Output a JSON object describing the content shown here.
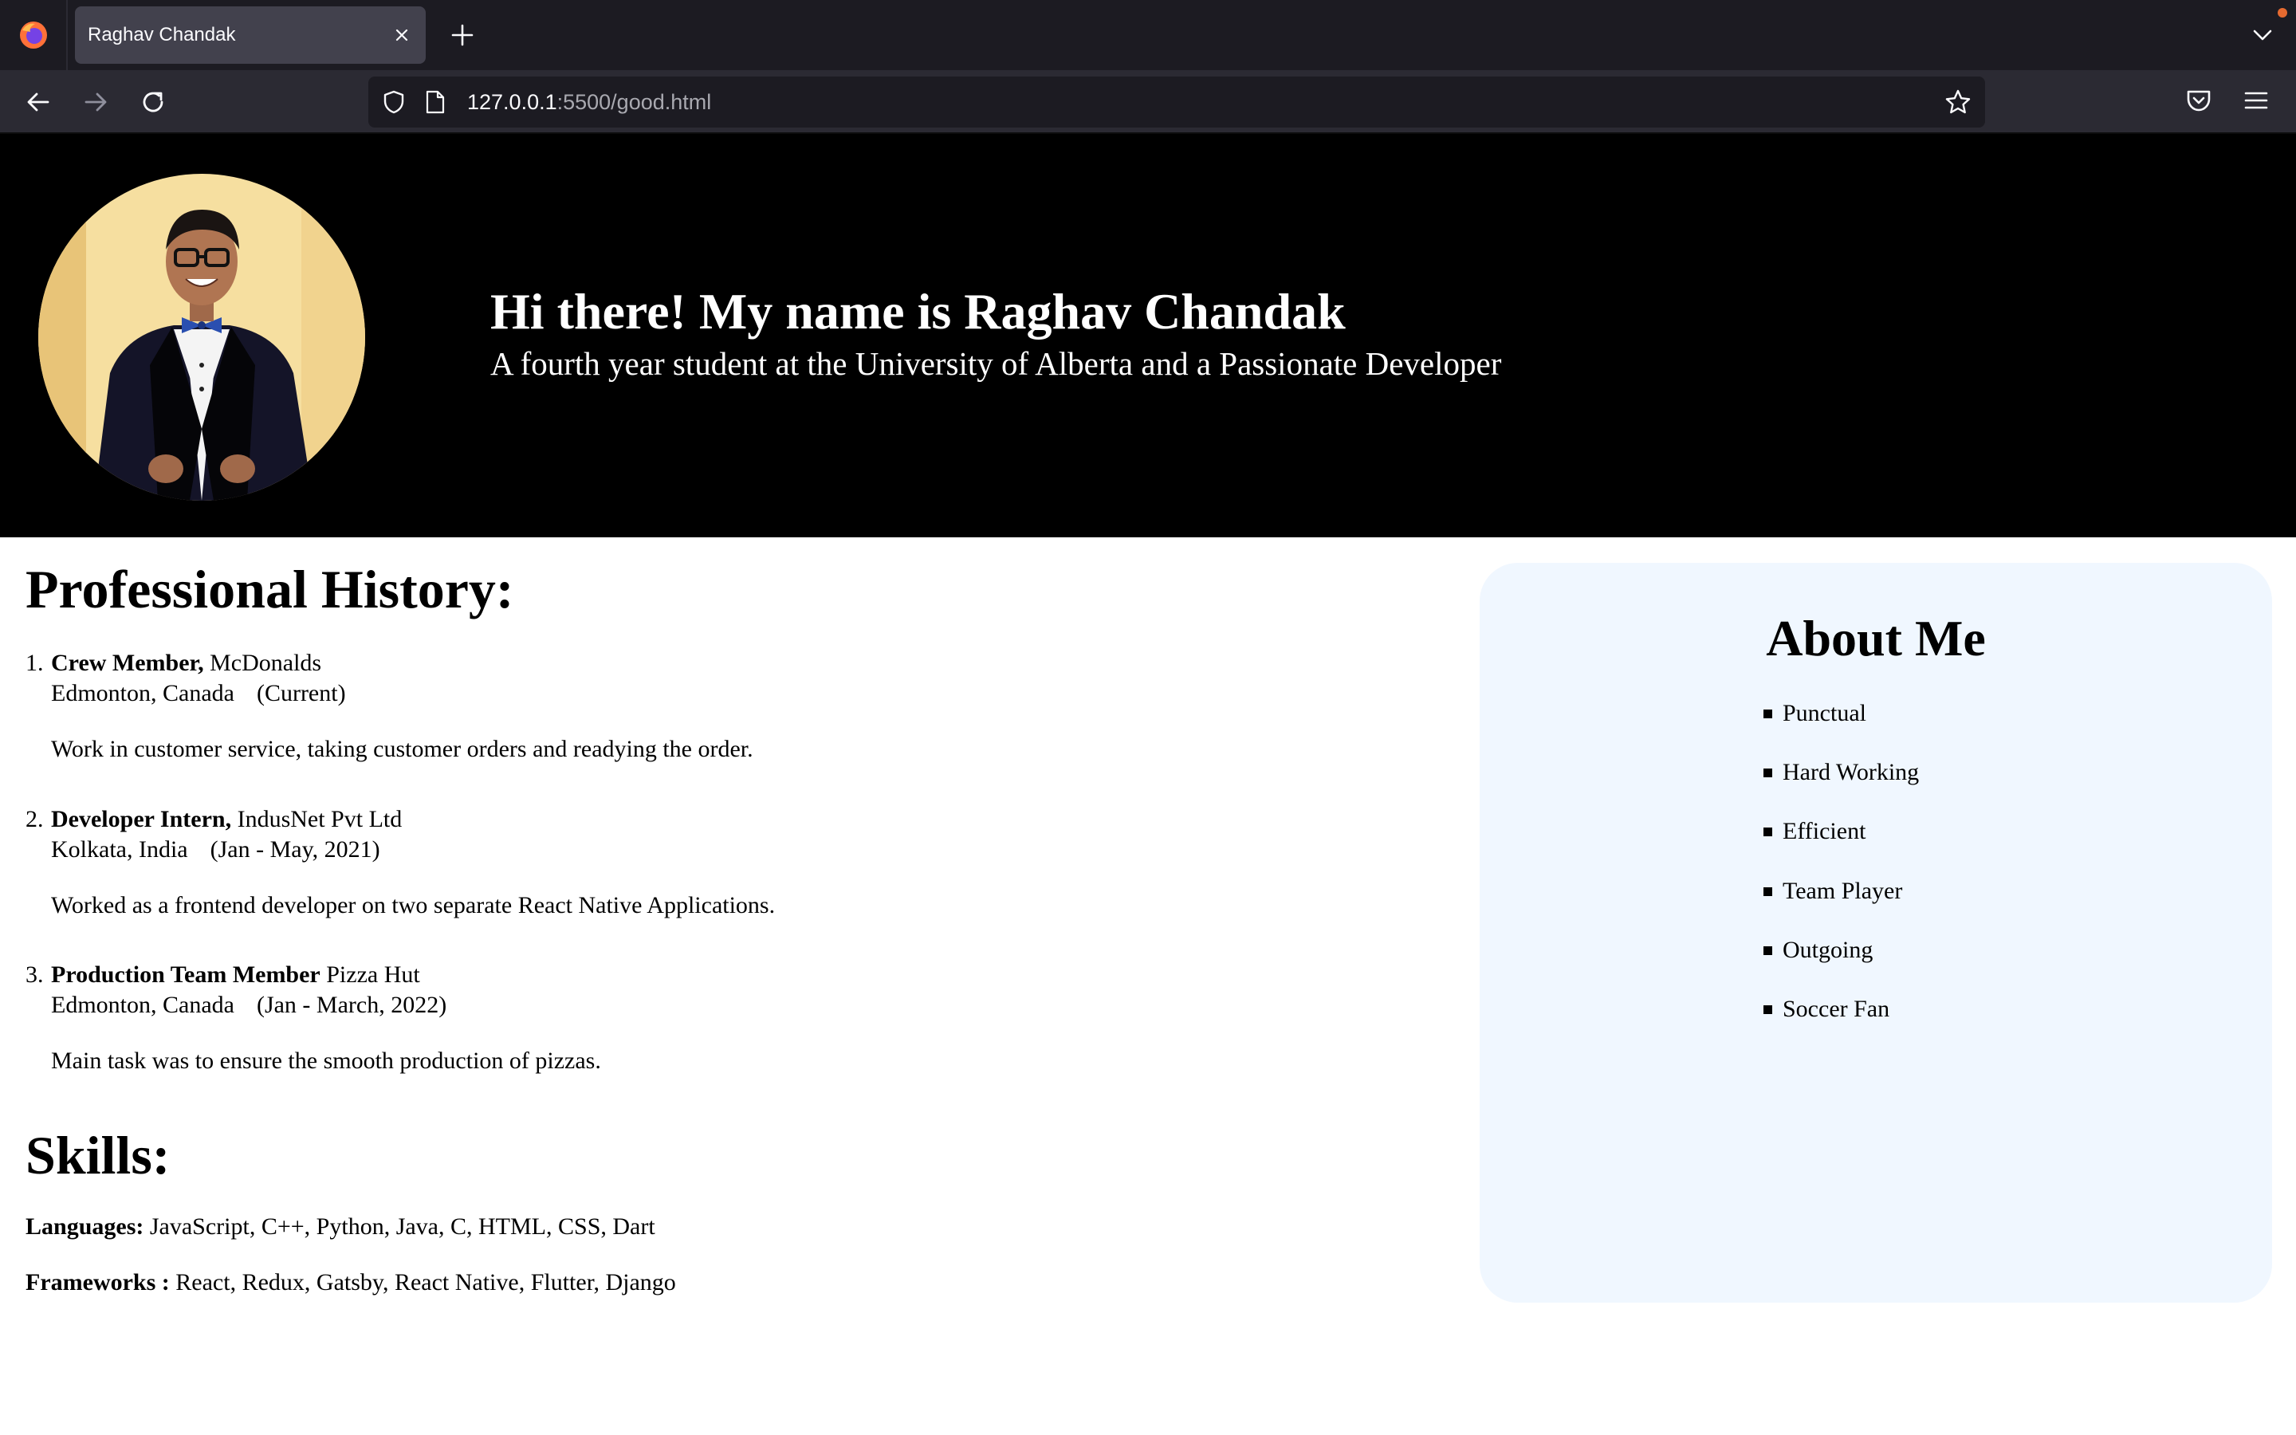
{
  "browser": {
    "tab_title": "Raghav Chandak",
    "url_host": "127.0.0.1",
    "url_rest": ":5500/good.html"
  },
  "hero": {
    "title": "Hi there! My name is Raghav Chandak",
    "subtitle": "A fourth year student at the University of Alberta and a Passionate Developer"
  },
  "history": {
    "heading": "Professional History:",
    "jobs": [
      {
        "number": "1.",
        "title": "Crew Member,",
        "company": "McDonalds",
        "location": "Edmonton, Canada",
        "period": "(Current)",
        "description": "Work in customer service, taking customer orders and readying the order."
      },
      {
        "number": "2.",
        "title": "Developer Intern,",
        "company": "IndusNet Pvt Ltd",
        "location": "Kolkata, India",
        "period": "(Jan - May, 2021)",
        "description": "Worked as a frontend developer on two separate React Native Applications."
      },
      {
        "number": "3.",
        "title": "Production Team Member",
        "company": "Pizza Hut",
        "location": "Edmonton, Canada",
        "period": "(Jan - March, 2022)",
        "description": "Main task was to ensure the smooth production of pizzas."
      }
    ]
  },
  "skills": {
    "heading": "Skills:",
    "languages_label": "Languages:",
    "languages": "JavaScript, C++, Python, Java, C, HTML, CSS, Dart",
    "frameworks_label": "Frameworks :",
    "frameworks": "React, Redux, Gatsby, React Native, Flutter, Django"
  },
  "about": {
    "heading": "About Me",
    "items": [
      "Punctual",
      "Hard Working",
      "Efficient",
      "Team Player",
      "Outgoing",
      "Soccer Fan"
    ]
  },
  "colors": {
    "hero_bg": "#000000",
    "about_bg": "#f0f7ff",
    "browser_tabstrip": "#1c1b22",
    "browser_toolbar": "#2b2a33"
  }
}
